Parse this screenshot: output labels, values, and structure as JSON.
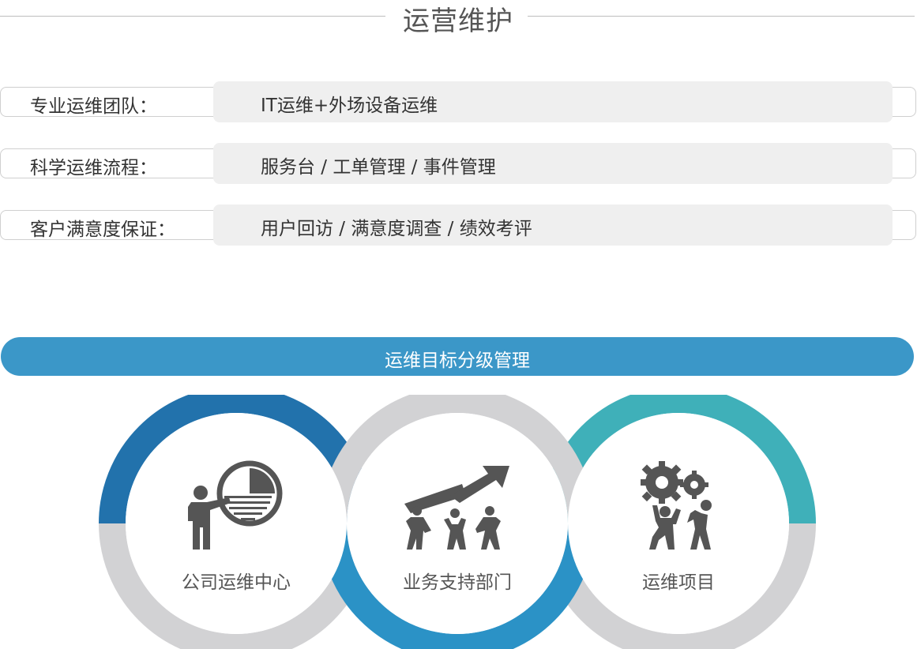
{
  "header": {
    "title": "运营维护"
  },
  "rows": [
    {
      "label": "专业运维团队：",
      "value": "IT运维+外场设备运维"
    },
    {
      "label": "科学运维流程：",
      "value": "服务台  /  工单管理  /  事件管理"
    },
    {
      "label": "客户满意度保证：",
      "value": "用户回访  /  满意度调查  /  绩效考评"
    }
  ],
  "banner": {
    "text": "运维目标分级管理"
  },
  "circles": [
    {
      "label": "公司运维中心",
      "icon": "presenter-chart-icon",
      "accent": "#2272ac"
    },
    {
      "label": "业务支持部门",
      "icon": "team-lifting-arrow-icon",
      "accent": "#2b92c6"
    },
    {
      "label": "运维项目",
      "icon": "gears-people-icon",
      "accent": "#3fb0b9"
    }
  ],
  "colors": {
    "ring_gray": "#d2d2d4",
    "icon_gray": "#555555",
    "banner": "#3b97c8",
    "row_bg": "#efefef"
  }
}
